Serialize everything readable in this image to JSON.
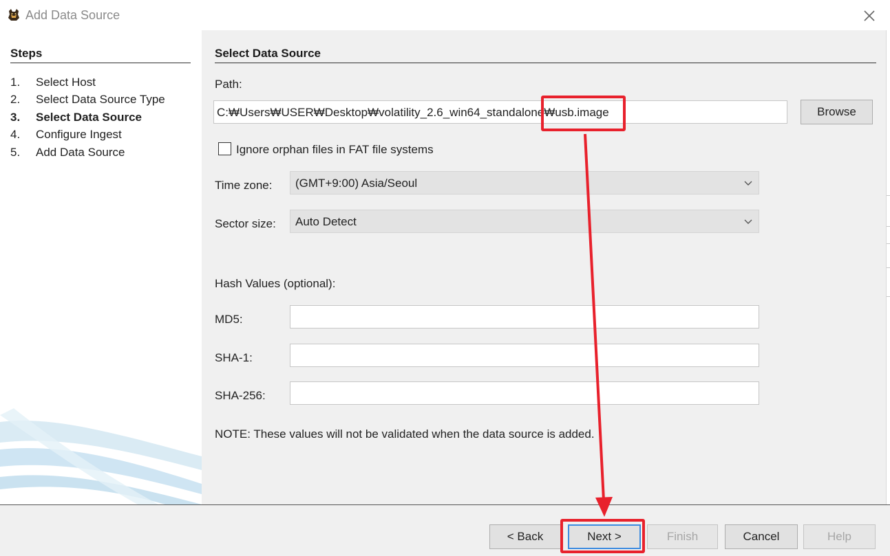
{
  "window": {
    "title": "Add Data Source"
  },
  "steps": {
    "heading": "Steps",
    "items": [
      {
        "num": "1.",
        "label": "Select Host"
      },
      {
        "num": "2.",
        "label": "Select Data Source Type"
      },
      {
        "num": "3.",
        "label": "Select Data Source"
      },
      {
        "num": "4.",
        "label": "Configure Ingest"
      },
      {
        "num": "5.",
        "label": "Add Data Source"
      }
    ],
    "active_index": 2
  },
  "main": {
    "heading": "Select Data Source",
    "path_label": "Path:",
    "path_value": "C:₩Users₩USER₩Desktop₩volatility_2.6_win64_standalone₩usb.image",
    "browse_label": "Browse",
    "ignore_orphan_label": "Ignore orphan files in FAT file systems",
    "ignore_orphan_checked": false,
    "timezone_label": "Time zone:",
    "timezone_value": "(GMT+9:00) Asia/Seoul",
    "sector_label": "Sector size:",
    "sector_value": "Auto Detect",
    "hash_heading": "Hash Values (optional):",
    "md5_label": "MD5:",
    "md5_value": "",
    "sha1_label": "SHA-1:",
    "sha1_value": "",
    "sha256_label": "SHA-256:",
    "sha256_value": "",
    "note": "NOTE: These values will not be validated when the data source is added."
  },
  "buttons": {
    "back": "< Back",
    "next": "Next >",
    "finish": "Finish",
    "cancel": "Cancel",
    "help": "Help"
  },
  "colors": {
    "annotation": "#e8212c",
    "panel_bg": "#f0f0f0",
    "default_button_border": "#3c8be0"
  },
  "icons": {
    "app": "autopsy-dog-icon",
    "close": "close-icon",
    "dropdown": "chevron-down-icon"
  }
}
